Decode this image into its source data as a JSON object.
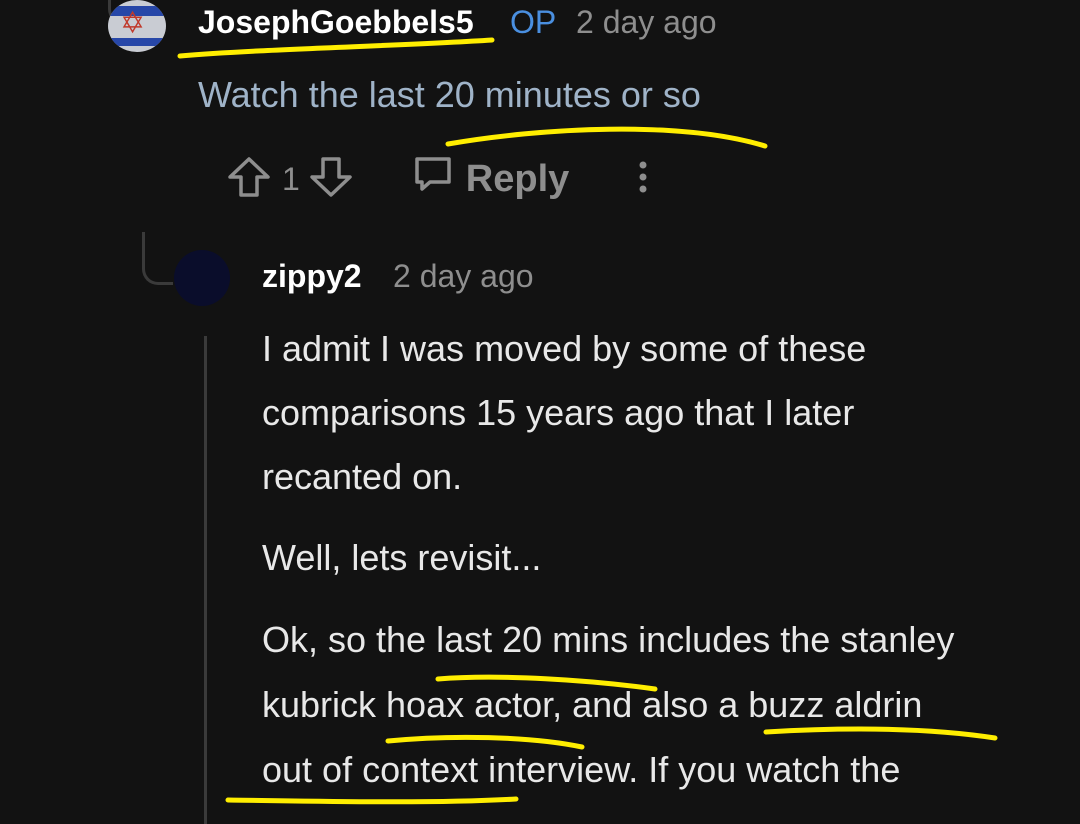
{
  "comment_op": {
    "username": "JosephGoebbels5",
    "op_badge": "OP",
    "timestamp": "2 day ago",
    "body": "Watch the last 20 minutes or so",
    "upvote_icon": "arrow-up-icon",
    "vote_count": "1",
    "downvote_icon": "arrow-down-icon",
    "reply_label": "Reply",
    "reply_icon": "speech-bubble-icon",
    "more_icon": "vertical-dots-icon"
  },
  "reply": {
    "username": "zippy2",
    "timestamp": "2 day ago",
    "lines": [
      "I admit I was moved by some of these",
      "comparisons 15 years ago that I later",
      "recanted on.",
      "Well, lets revisit...",
      "Ok, so the last 20 mins includes the stanley",
      "kubrick hoax actor, and also a buzz aldrin",
      "out of context interview. If you watch the"
    ]
  },
  "colors": {
    "background": "#121212",
    "username": "#ffffff",
    "op_badge": "#4a8fe0",
    "muted": "#8e8e8e",
    "op_body": "#9fb3c8",
    "highlight_marker": "#ffee00"
  }
}
